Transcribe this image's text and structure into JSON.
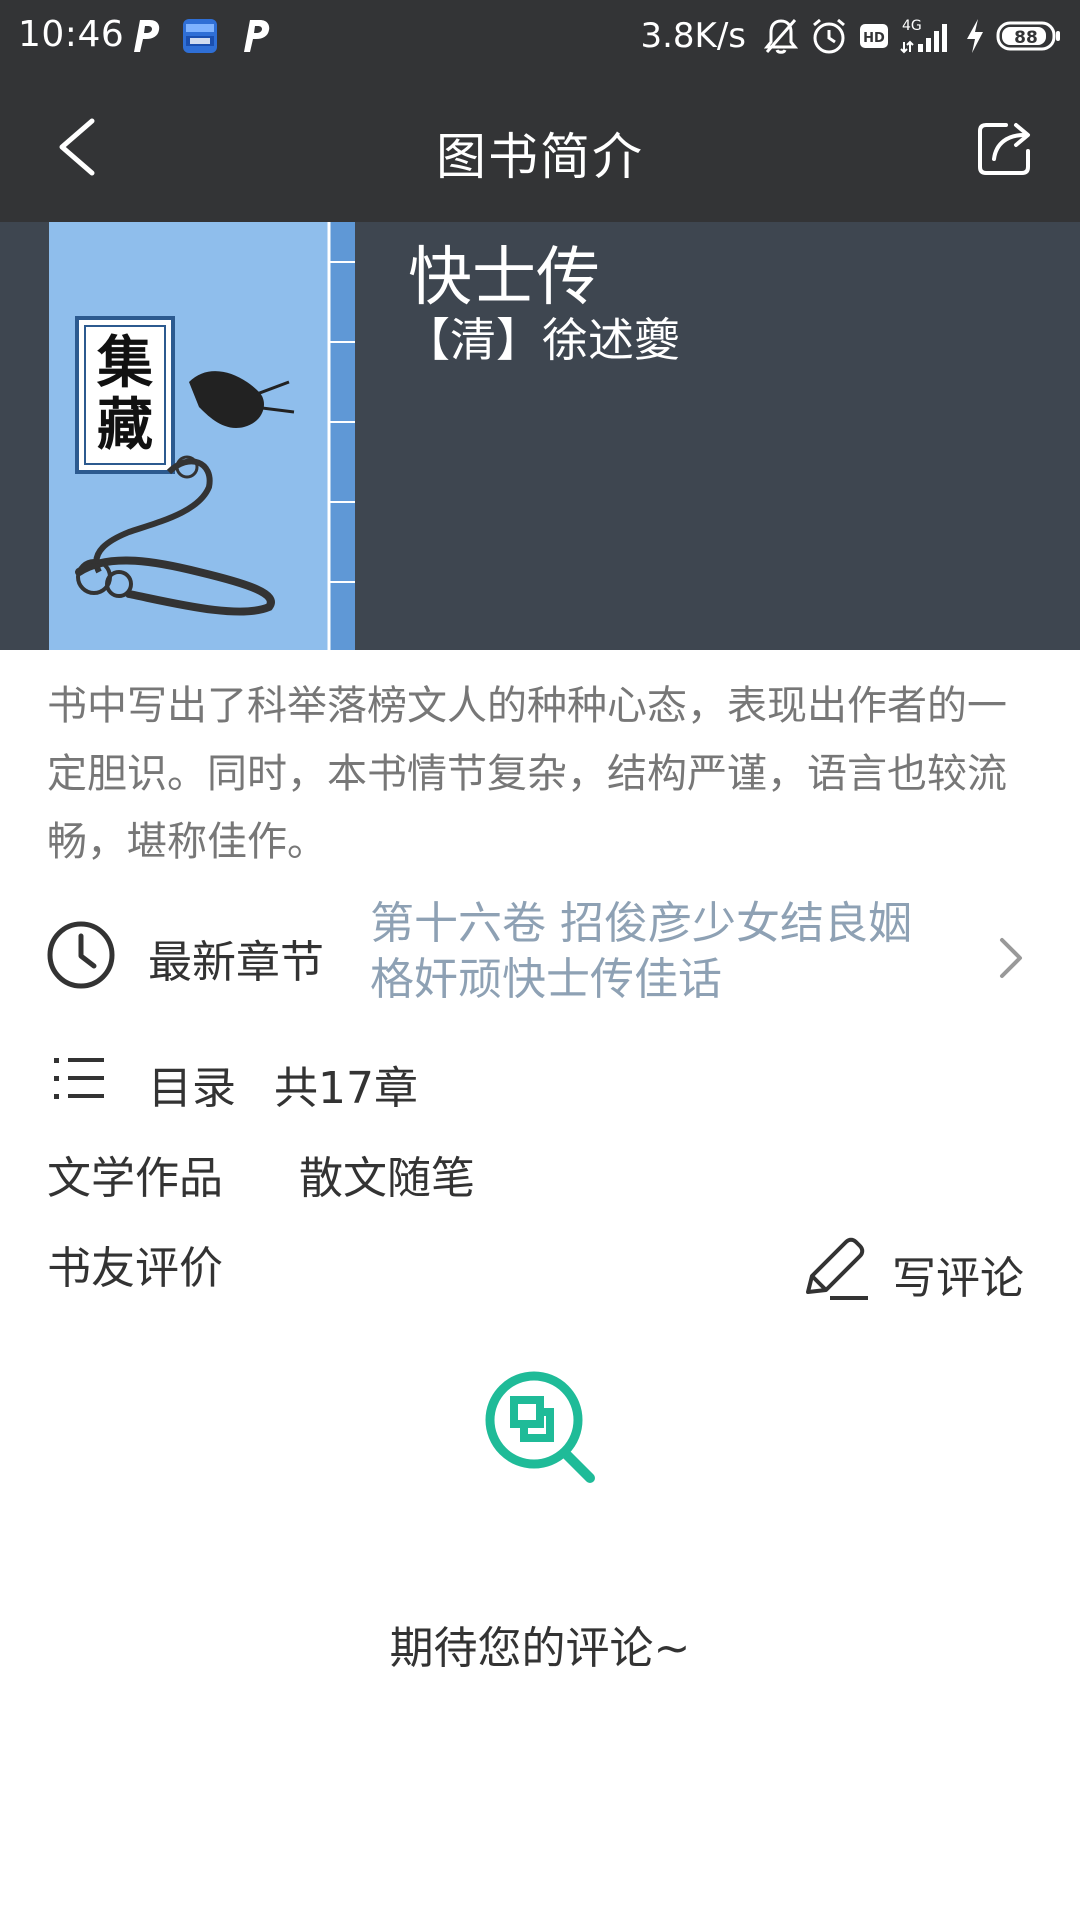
{
  "status_bar": {
    "time": "10:46",
    "network_speed": "3.8K/s",
    "network_type": "4G",
    "battery": "88",
    "icons": [
      "p-app-icon",
      "news-app-icon",
      "p-app-icon",
      "mute-icon",
      "alarm-icon",
      "hd-icon",
      "signal-icon",
      "charging-icon",
      "battery-icon"
    ]
  },
  "toolbar": {
    "title": "图书简介",
    "back_icon": "back-chevron-icon",
    "share_icon": "share-icon"
  },
  "book": {
    "title": "快士传",
    "author": "【清】徐述夔",
    "cover_text": "集藏",
    "summary": "书中写出了科举落榜文人的种种心态，表现出作者的一定胆识。同时，本书情节复杂，结构严谨，语言也较流畅，堪称佳作。"
  },
  "latest": {
    "label": "最新章节",
    "chapter_line1": "第十六卷 招俊彦少女结良姻",
    "chapter_line2": "格奸顽快士传佳话"
  },
  "toc": {
    "label": "目录",
    "count": "共17章"
  },
  "tags": [
    "文学作品",
    "散文随笔"
  ],
  "reviews": {
    "title": "书友评价",
    "write_label": "写评论",
    "empty_text": "期待您的评论~"
  },
  "colors": {
    "bar_bg": "#333436",
    "header_bg": "#3e4650",
    "cover_bg": "#8fbeec",
    "accent_green": "#1fbb98",
    "chapter_text": "#8ea1b4",
    "summary_text": "#777777"
  }
}
